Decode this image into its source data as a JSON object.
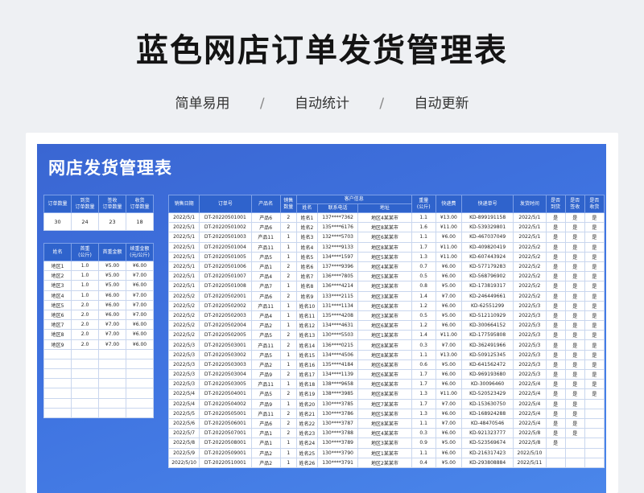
{
  "header": {
    "title": "蓝色网店订单发货管理表",
    "features": [
      "简单易用",
      "自动统计",
      "自动更新"
    ],
    "separator": "/"
  },
  "sheet": {
    "title": "网店发货管理表"
  },
  "stats": {
    "headers": [
      "订单数量",
      "到货\n订单数量",
      "签收\n订单数量",
      "收货\n订单数量"
    ],
    "values": [
      "30",
      "24",
      "23",
      "18"
    ]
  },
  "regions": {
    "headers": [
      "姓名",
      "首重\n(公斤)",
      "首重金额",
      "续重金额\n(元/公斤)"
    ],
    "rows": [
      [
        "地区1",
        "1.0",
        "¥5.00",
        "¥6.00"
      ],
      [
        "地区2",
        "1.0",
        "¥5.00",
        "¥7.00"
      ],
      [
        "地区3",
        "1.0",
        "¥5.00",
        "¥6.00"
      ],
      [
        "地区4",
        "1.0",
        "¥6.00",
        "¥7.00"
      ],
      [
        "地区5",
        "2.0",
        "¥6.00",
        "¥7.00"
      ],
      [
        "地区6",
        "2.0",
        "¥6.00",
        "¥7.00"
      ],
      [
        "地区7",
        "2.0",
        "¥7.00",
        "¥6.00"
      ],
      [
        "地区8",
        "2.0",
        "¥7.00",
        "¥6.00"
      ],
      [
        "地区9",
        "2.0",
        "¥7.00",
        "¥6.00"
      ],
      [
        "",
        "",
        "",
        ""
      ],
      [
        "",
        "",
        "",
        ""
      ],
      [
        "",
        "",
        "",
        ""
      ],
      [
        "",
        "",
        "",
        ""
      ],
      [
        "",
        "",
        "",
        ""
      ],
      [
        "",
        "",
        "",
        ""
      ],
      [
        "",
        "",
        "",
        ""
      ]
    ]
  },
  "orders": {
    "headers": {
      "date": "销售日期",
      "order_no": "订单号",
      "product": "产品名",
      "qty": "销售\n数量",
      "customer_group": "客户信息",
      "name": "姓名",
      "phone": "联系电话",
      "address": "地址",
      "weight": "重量\n(公斤)",
      "fee": "快递费",
      "tracking": "快递单号",
      "ship_time": "发货时间",
      "arrived": "是否\n到货",
      "signed": "是否\n签收",
      "received": "是否\n收货"
    },
    "rows": [
      [
        "2022/5/1",
        "DT-20220501001",
        "产品6",
        "2",
        "姓名1",
        "137****7362",
        "地区4某某市",
        "1.1",
        "¥13.00",
        "KD-899191158",
        "2022/5/1",
        "是",
        "是",
        "是"
      ],
      [
        "2022/5/1",
        "DT-20220501002",
        "产品6",
        "2",
        "姓名2",
        "135****6176",
        "地区8某某市",
        "1.6",
        "¥11.00",
        "KD-539329801",
        "2022/5/1",
        "是",
        "是",
        "是"
      ],
      [
        "2022/5/1",
        "DT-20220501003",
        "产品11",
        "1",
        "姓名3",
        "132****5703",
        "地区6某某市",
        "1.1",
        "¥6.00",
        "KD-467037049",
        "2022/5/1",
        "是",
        "是",
        "是"
      ],
      [
        "2022/5/1",
        "DT-20220501004",
        "产品11",
        "1",
        "姓名4",
        "132****9133",
        "地区8某某市",
        "1.7",
        "¥11.00",
        "KD-409820419",
        "2022/5/2",
        "是",
        "是",
        "是"
      ],
      [
        "2022/5/1",
        "DT-20220501005",
        "产品5",
        "1",
        "姓名5",
        "134****1597",
        "地区5某某市",
        "1.3",
        "¥11.00",
        "KD-607443924",
        "2022/5/2",
        "是",
        "是",
        "是"
      ],
      [
        "2022/5/1",
        "DT-20220501006",
        "产品1",
        "2",
        "姓名6",
        "137****9396",
        "地区4某某市",
        "0.7",
        "¥6.00",
        "KD-577179283",
        "2022/5/2",
        "是",
        "是",
        "是"
      ],
      [
        "2022/5/1",
        "DT-20220501007",
        "产品4",
        "2",
        "姓名7",
        "136****7805",
        "地区5某某市",
        "0.5",
        "¥6.00",
        "KD-568796902",
        "2022/5/2",
        "是",
        "是",
        "是"
      ],
      [
        "2022/5/1",
        "DT-20220501008",
        "产品7",
        "1",
        "姓名8",
        "136****4214",
        "地区3某某市",
        "0.8",
        "¥5.00",
        "KD-173819317",
        "2022/5/2",
        "是",
        "是",
        "是"
      ],
      [
        "2022/5/2",
        "DT-20220502001",
        "产品6",
        "2",
        "姓名9",
        "133****2115",
        "地区3某某市",
        "1.4",
        "¥7.00",
        "KD-246449661",
        "2022/5/2",
        "是",
        "是",
        "是"
      ],
      [
        "2022/5/2",
        "DT-20220502002",
        "产品11",
        "1",
        "姓名10",
        "131****1134",
        "地区6某某市",
        "1.2",
        "¥6.00",
        "KD-62551299",
        "2022/5/3",
        "是",
        "是",
        "是"
      ],
      [
        "2022/5/2",
        "DT-20220502003",
        "产品4",
        "1",
        "姓名11",
        "135****4208",
        "地区3某某市",
        "0.5",
        "¥5.00",
        "KD-512110929",
        "2022/5/3",
        "是",
        "是",
        "是"
      ],
      [
        "2022/5/2",
        "DT-20220502004",
        "产品2",
        "1",
        "姓名12",
        "134****4631",
        "地区6某某市",
        "1.2",
        "¥6.00",
        "KD-300664152",
        "2022/5/3",
        "是",
        "是",
        "是"
      ],
      [
        "2022/5/2",
        "DT-20220502005",
        "产品5",
        "2",
        "姓名13",
        "130****5503",
        "地区1某某市",
        "1.4",
        "¥11.00",
        "KD-177595808",
        "2022/5/3",
        "是",
        "是",
        "是"
      ],
      [
        "2022/5/3",
        "DT-20220503001",
        "产品11",
        "2",
        "姓名14",
        "136****0215",
        "地区8某某市",
        "0.3",
        "¥7.00",
        "KD-362491966",
        "2022/5/3",
        "是",
        "是",
        "是"
      ],
      [
        "2022/5/3",
        "DT-20220503002",
        "产品5",
        "1",
        "姓名15",
        "134****4506",
        "地区8某某市",
        "1.1",
        "¥13.00",
        "KD-509125345",
        "2022/5/3",
        "是",
        "是",
        "是"
      ],
      [
        "2022/5/3",
        "DT-20220503003",
        "产品2",
        "1",
        "姓名16",
        "135****4184",
        "地区6某某市",
        "0.6",
        "¥5.00",
        "KD-641562472",
        "2022/5/3",
        "是",
        "是",
        "是"
      ],
      [
        "2022/5/3",
        "DT-20220503004",
        "产品9",
        "2",
        "姓名17",
        "134****1139",
        "地区6某某市",
        "1.7",
        "¥6.00",
        "KD-969193680",
        "2022/5/3",
        "是",
        "是",
        "是"
      ],
      [
        "2022/5/3",
        "DT-20220503005",
        "产品11",
        "1",
        "姓名18",
        "138****9658",
        "地区6某某市",
        "1.7",
        "¥6.00",
        "KD-30096460",
        "2022/5/4",
        "是",
        "是",
        "是"
      ],
      [
        "2022/5/4",
        "DT-20220504001",
        "产品5",
        "2",
        "姓名19",
        "138****3985",
        "地区8某某市",
        "1.3",
        "¥11.00",
        "KD-520523429",
        "2022/5/4",
        "是",
        "是",
        "是"
      ],
      [
        "2022/5/4",
        "DT-20220504002",
        "产品9",
        "1",
        "姓名20",
        "130****3785",
        "地区7某某市",
        "1.7",
        "¥7.00",
        "KD-153630750",
        "2022/5/4",
        "是",
        "是",
        ""
      ],
      [
        "2022/5/5",
        "DT-20220505001",
        "产品11",
        "2",
        "姓名21",
        "130****3786",
        "地区5某某市",
        "1.3",
        "¥6.00",
        "KD-168924288",
        "2022/5/4",
        "是",
        "是",
        ""
      ],
      [
        "2022/5/6",
        "DT-20220506001",
        "产品6",
        "2",
        "姓名22",
        "130****3787",
        "地区8某某市",
        "1.1",
        "¥7.00",
        "KD-48470546",
        "2022/5/4",
        "是",
        "是",
        ""
      ],
      [
        "2022/5/7",
        "DT-20220507001",
        "产品1",
        "2",
        "姓名23",
        "130****3788",
        "地区4某某市",
        "0.3",
        "¥6.00",
        "KD-921323777",
        "2022/5/8",
        "是",
        "是",
        ""
      ],
      [
        "2022/5/8",
        "DT-20220508001",
        "产品1",
        "1",
        "姓名24",
        "130****3789",
        "地区3某某市",
        "0.9",
        "¥5.00",
        "KD-523569674",
        "2022/5/8",
        "是",
        "",
        ""
      ],
      [
        "2022/5/9",
        "DT-20220509001",
        "产品2",
        "1",
        "姓名25",
        "130****3790",
        "地区1某某市",
        "1.1",
        "¥6.00",
        "KD-216317423",
        "2022/5/10",
        "",
        "",
        ""
      ],
      [
        "2022/5/10",
        "DT-20220510001",
        "产品2",
        "1",
        "姓名26",
        "130****3791",
        "地区2某某市",
        "0.4",
        "¥5.00",
        "KD-293808884",
        "2022/5/11",
        "",
        "",
        ""
      ]
    ]
  }
}
